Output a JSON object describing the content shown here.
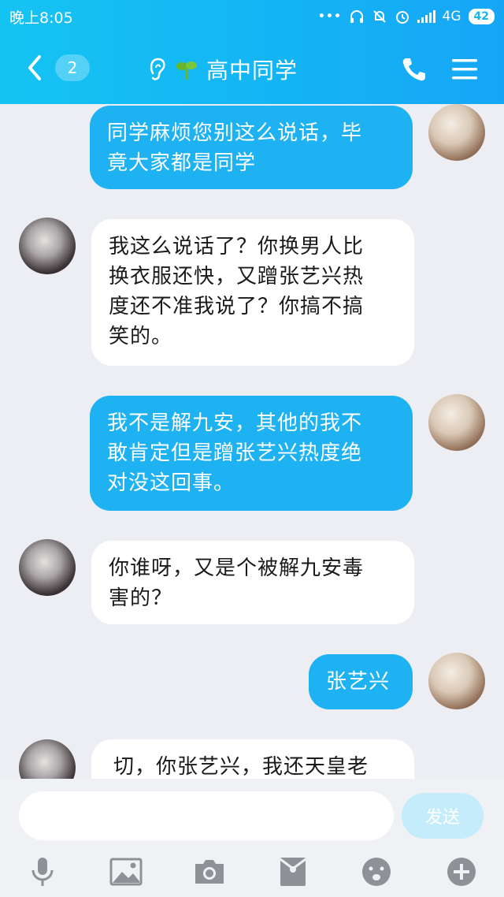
{
  "status_bar": {
    "time": "晚上8:05",
    "network": "4G",
    "battery": "42"
  },
  "header": {
    "back_count": "2",
    "title": "高中同学"
  },
  "messages": [
    {
      "side": "out",
      "lines": [
        "同学麻烦您别这么说话，毕",
        "竟大家都是同学"
      ]
    },
    {
      "side": "in",
      "lines": [
        "我这么说话了？你换男人比",
        "换衣服还快，又蹭张艺兴热",
        "度还不准我说了？你搞不搞",
        "笑的。"
      ]
    },
    {
      "side": "out",
      "lines": [
        "我不是解九安，其他的我不",
        "敢肯定但是蹭张艺兴热度绝",
        "对没这回事。"
      ]
    },
    {
      "side": "in",
      "lines": [
        "你谁呀，又是个被解九安毒",
        "害的？"
      ]
    },
    {
      "side": "out",
      "lines": [
        "张艺兴"
      ]
    },
    {
      "side": "in",
      "lines": [
        "切，你张艺兴，我还天皇老"
      ]
    }
  ],
  "input": {
    "placeholder": "",
    "send_label": "发送"
  },
  "colors": {
    "header_start": "#15c3f2",
    "header_end": "#16a6f6",
    "outgoing_bubble": "#1eb2f3",
    "incoming_bubble": "#ffffff",
    "background": "#eceef3",
    "send_button": "#c5ecfb"
  },
  "icons": {
    "toolbar": [
      "microphone-icon",
      "image-icon",
      "camera-icon",
      "red-packet-icon",
      "emoji-icon",
      "plus-icon"
    ]
  }
}
